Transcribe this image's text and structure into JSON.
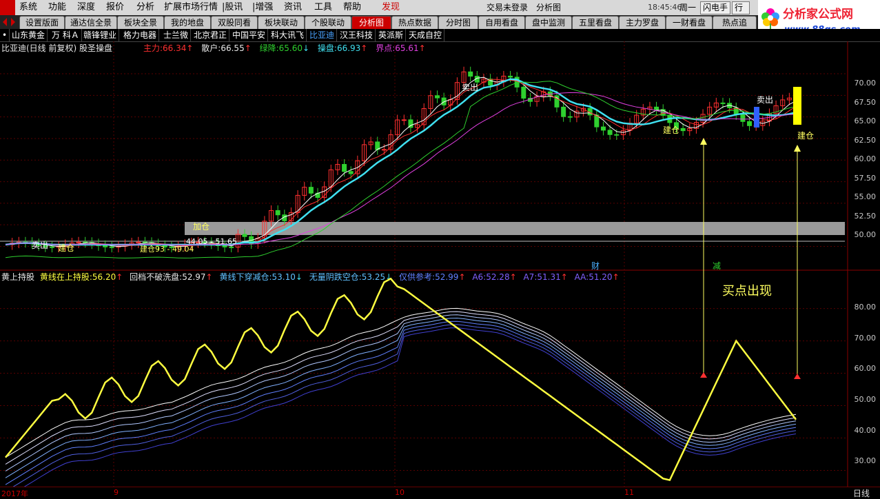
{
  "menu": [
    "系统",
    "功能",
    "深度",
    "报价",
    "分析",
    "扩展市场行情",
    "|股讯",
    "|增强",
    "资讯",
    "工具",
    "帮助",
    "发现"
  ],
  "status": {
    "login": "交易未登录",
    "view": "分析图",
    "time": "18:45:46",
    "weekday": "周一",
    "btn1": "闪电手",
    "btn2": "行"
  },
  "watermark": {
    "title": "分析家公式网",
    "url": "www.88gs.com"
  },
  "tabs": [
    "设置版面",
    "通达信全景",
    "板块全景",
    "我的地盘",
    "双股同看",
    "板块联动",
    "个股联动",
    "分析图",
    "热点数据",
    "分时图",
    "自用看盘",
    "盘中监测",
    "五里看盘",
    "主力罗盘",
    "一财看盘",
    "热点追"
  ],
  "stocks": [
    "•",
    "山东黄金",
    "万 科Ａ",
    "赣锋锂业",
    "格力电器",
    "士兰微",
    "北京君正",
    "中国平安",
    "科大讯飞",
    "比亚迪",
    "汉王科技",
    "英派斯",
    "天成自控"
  ],
  "main_header": {
    "title": "比亚迪(日线 前复权) 股圣操盘",
    "items": [
      {
        "label": "主力:",
        "value": "66.34",
        "arrow": "↑",
        "color": "#ff3030"
      },
      {
        "label": "散户:",
        "value": "66.55",
        "arrow": "↑",
        "color": "#e8e8e8"
      },
      {
        "label": "绿降:",
        "value": "65.60",
        "arrow": "↓",
        "color": "#2fd02f"
      },
      {
        "label": "操盘:",
        "value": "66.93",
        "arrow": "↑",
        "color": "#40e0f0"
      },
      {
        "label": "界点:",
        "value": "65.61",
        "arrow": "↑",
        "color": "#e040e0"
      }
    ]
  },
  "main_axis": [
    "70.00",
    "67.50",
    "65.00",
    "62.50",
    "60.00",
    "57.50",
    "55.00",
    "52.50",
    "50.00"
  ],
  "main_annotations": {
    "jiacang": "加仓",
    "jiancang": "建仓",
    "maichu": "卖出",
    "range1": "44.05 - 51.65",
    "range2": "建仓93 - 49.04",
    "cai": "财",
    "jian": "减"
  },
  "sub_header": {
    "title": "黄上持股",
    "items": [
      {
        "label": "黄线在上持股:",
        "value": "56.20",
        "arrow": "↑",
        "color": "#ffff40"
      },
      {
        "label": "回档不破洗盘:",
        "value": "52.97",
        "arrow": "↑",
        "color": "#e8e8e8"
      },
      {
        "label": "黄线下穿减仓:",
        "value": "53.10",
        "arrow": "↓",
        "color": "#60c0ff"
      },
      {
        "label": "无量阴跌空仓:",
        "value": "53.25",
        "arrow": "↓",
        "color": "#60c0ff"
      },
      {
        "label": "仅供参考:",
        "value": "52.99",
        "arrow": "↑",
        "color": "#6080ff"
      },
      {
        "label": "A6:",
        "value": "52.28",
        "arrow": "↑",
        "color": "#8060ff"
      },
      {
        "label": "A7:",
        "value": "51.31",
        "arrow": "↑",
        "color": "#8060ff"
      },
      {
        "label": "AA:",
        "value": "51.20",
        "arrow": "↑",
        "color": "#8060ff"
      }
    ]
  },
  "sub_axis": [
    "80.00",
    "70.00",
    "60.00",
    "50.00",
    "40.00",
    "30.00"
  ],
  "sub_annotation": "买点出现",
  "time_axis": [
    "2017年",
    "9",
    "10",
    "11"
  ],
  "period": "日线",
  "chart_data": [
    {
      "type": "candlestick",
      "title": "比亚迪(日线 前复权) 股圣操盘",
      "ylim": [
        49,
        72
      ],
      "yticks": [
        50,
        52.5,
        55,
        57.5,
        60,
        62.5,
        65,
        67.5,
        70
      ],
      "series": [
        {
          "name": "主力",
          "last": 66.34
        },
        {
          "name": "散户",
          "last": 66.55
        },
        {
          "name": "绿降",
          "last": 65.6
        },
        {
          "name": "操盘",
          "last": 66.93
        },
        {
          "name": "界点",
          "last": 65.61
        }
      ],
      "band": [
        50,
        51.6
      ]
    },
    {
      "type": "line",
      "title": "黄上持股",
      "ylim": [
        25,
        88
      ],
      "yticks": [
        30,
        40,
        50,
        60,
        70,
        80
      ],
      "series": [
        {
          "name": "黄线在上持股",
          "last": 56.2
        },
        {
          "name": "回档不破洗盘",
          "last": 52.97
        },
        {
          "name": "黄线下穿减仓",
          "last": 53.1
        },
        {
          "name": "无量阴跌空仓",
          "last": 53.25
        },
        {
          "name": "仅供参考",
          "last": 52.99
        },
        {
          "name": "A6",
          "last": 52.28
        },
        {
          "name": "A7",
          "last": 51.31
        },
        {
          "name": "AA",
          "last": 51.2
        }
      ]
    }
  ]
}
